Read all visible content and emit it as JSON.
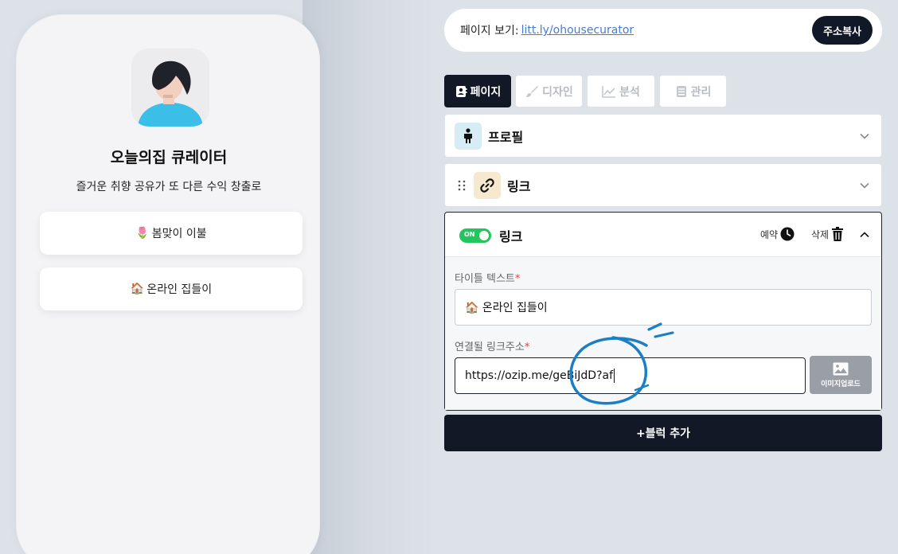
{
  "preview": {
    "profile_name": "오늘의집 큐레이터",
    "bio": "즐거운 취향 공유가 또 다른 수익 창출로",
    "links": [
      {
        "emoji": "🌷",
        "label": "봄맞이 이불"
      },
      {
        "emoji": "🏠",
        "label": "온라인 집들이"
      }
    ]
  },
  "header": {
    "page_view_label": "페이지 보기:",
    "page_url": "litt.ly/ohousecurator",
    "copy_button": "주소복사"
  },
  "tabs": [
    {
      "label": "페이지",
      "icon": "contact-book-icon",
      "active": true
    },
    {
      "label": "디자인",
      "icon": "brush-icon",
      "active": false
    },
    {
      "label": "분석",
      "icon": "chart-line-icon",
      "active": false
    },
    {
      "label": "관리",
      "icon": "database-icon",
      "active": false
    }
  ],
  "blocks": {
    "profile": {
      "title": "프로필",
      "icon": "person-icon",
      "icon_bg": "#d6edf5"
    },
    "link_collapsed": {
      "title": "링크",
      "icon": "link-icon",
      "icon_bg": "#f7e9d0"
    },
    "link_editor": {
      "toggle_label": "ON",
      "title": "링크",
      "schedule_label": "예약",
      "delete_label": "삭제",
      "title_field_label": "타이틀 텍스트",
      "required_mark": "*",
      "title_value": "🏠 온라인 집들이",
      "url_field_label": "연결될 링크주소",
      "url_value": "https://ozip.me/geBiJdD?af",
      "upload_label": "이미지업로드"
    }
  },
  "add_block_button": "+블럭 추가",
  "colors": {
    "dark": "#121826",
    "toggle_green": "#22c55e",
    "annotation_blue": "#1a7fc4",
    "link_blue": "#4a7bd0"
  }
}
